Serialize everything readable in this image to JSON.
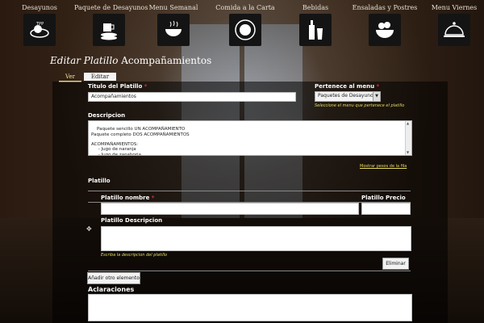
{
  "nav": {
    "items": [
      {
        "label": "Desayunos",
        "icon": "cup-plate-icon"
      },
      {
        "label": "Paquete de Desayunos",
        "icon": "mug-pancakes-icon"
      },
      {
        "label": "Menu Semanal",
        "icon": "soup-bowl-icon"
      },
      {
        "label": "Comida a la Carta",
        "icon": "plate-icon"
      },
      {
        "label": "Bebidas",
        "icon": "bottle-glass-icon"
      },
      {
        "label": "Ensaladas y Postres",
        "icon": "salad-bowl-icon"
      },
      {
        "label": "Menu Viernes",
        "icon": "cloche-icon"
      }
    ]
  },
  "page": {
    "title_prefix": "Editar Platillo",
    "title_name": "Acompañamientos"
  },
  "tabs": {
    "ver": "Ver",
    "editar": "Editar"
  },
  "form": {
    "titulo_label": "Titulo del Platillo",
    "titulo_value": "Acompañamientos",
    "menu_label": "Pertenece al menu",
    "menu_value": "Paquetes de Desayunos",
    "menu_hint": "Seleccione el menu que pertenece el platillo",
    "descripcion_label": "Descripcion",
    "descripcion_value": "Paquete sencillo UN ACOMPAÑAMIENTO\nPaquete completo DOS ACOMPAÑAMIENTOS\n\nACOMPAÑAMIENTOS:\n     - Jugo de naranja\n     - Jugo de zanahoria",
    "weights_link": "Mostrar pesos de la fila",
    "platillo_label": "Platillo",
    "nombre_label": "Platillo nombre",
    "precio_label": "Platillo Precio",
    "desc_field_label": "Platillo Descripcion",
    "desc_hint": "Escriba la descripcion del platillo",
    "eliminar_button": "Eliminar",
    "add_button": "Añadir otro elemento",
    "aclaraciones_label": "Aclaraciones",
    "drag_handle": "✥",
    "required_mark": "*"
  },
  "colors": {
    "accent_yellow": "#e7dc62",
    "required_red": "#d03030"
  }
}
